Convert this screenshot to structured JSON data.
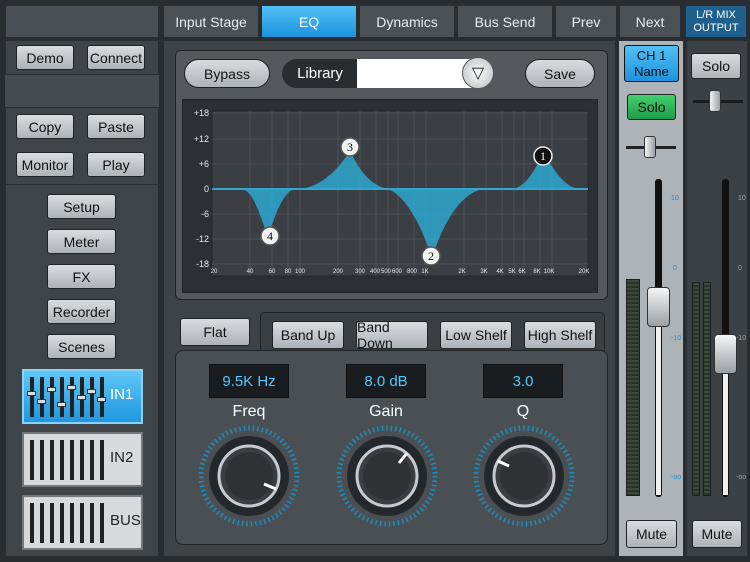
{
  "tabs": [
    "Input Stage",
    "EQ",
    "Dynamics",
    "Bus Send",
    "Prev",
    "Next"
  ],
  "output_tab": "L/R MIX\nOUTPUT",
  "sidebar": {
    "demo": "Demo",
    "connect": "Connect",
    "copy": "Copy",
    "paste": "Paste",
    "monitor": "Monitor",
    "play": "Play",
    "menu": [
      "Setup",
      "Meter",
      "FX",
      "Recorder",
      "Scenes"
    ],
    "channels": [
      "IN1",
      "IN2",
      "BUS"
    ]
  },
  "eq": {
    "bypass": "Bypass",
    "library": "Library",
    "library_value": "",
    "save": "Save",
    "y_ticks": [
      "+18",
      "+12",
      "+6",
      "0",
      "-6",
      "-12",
      "-18"
    ],
    "x_ticks": [
      "20",
      "40",
      "60",
      "80",
      "100",
      "200",
      "300",
      "400",
      "500",
      "600",
      "800",
      "1K",
      "2K",
      "3K",
      "4K",
      "5K",
      "6K",
      "8K",
      "10K",
      "20K"
    ],
    "bands": [
      "1",
      "2",
      "3",
      "4"
    ],
    "flat": "Flat",
    "band_buttons": [
      "Band Up",
      "Band Down",
      "Low Shelf",
      "High Shelf"
    ],
    "freq_value": "9.5K Hz",
    "gain_value": "8.0 dB",
    "q_value": "3.0",
    "freq_label": "Freq",
    "gain_label": "Gain",
    "q_label": "Q"
  },
  "channel_strip": {
    "name": "CH 1\nName",
    "solo": "Solo",
    "mute": "Mute",
    "scale": [
      "10",
      "0",
      "-10",
      "-oo"
    ]
  },
  "master_strip": {
    "solo": "Solo",
    "mute": "Mute",
    "scale": [
      "10",
      "0",
      "-10",
      "-oo"
    ]
  },
  "colors": {
    "accent": "#1d93de",
    "curve": "#2ea8cf",
    "solo_green": "#2fb65a"
  }
}
